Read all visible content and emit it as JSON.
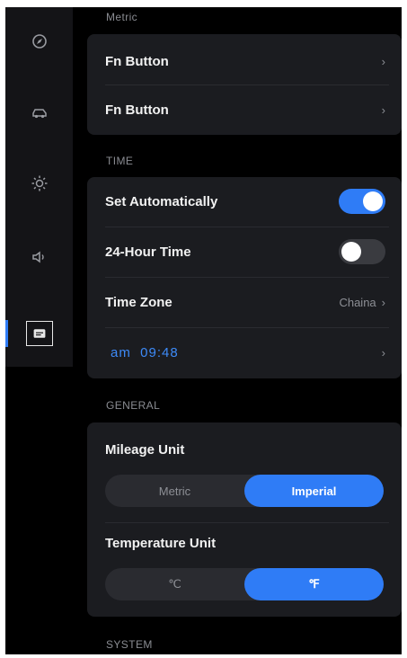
{
  "sections": {
    "metric": "Metric",
    "time": "TIME",
    "general": "GENERAL",
    "system": "SYSTEM"
  },
  "metric_card": {
    "rows": [
      {
        "label": "Fn Button"
      },
      {
        "label": "Fn Button"
      }
    ]
  },
  "time_card": {
    "set_automatically": {
      "label": "Set Automatically",
      "on": true
    },
    "hour24": {
      "label": "24-Hour Time",
      "on": false
    },
    "time_zone": {
      "label": "Time Zone",
      "value": "Chaina"
    },
    "clock": {
      "value": "am  09:48"
    }
  },
  "general_card": {
    "mileage": {
      "label": "Mileage Unit",
      "options": [
        "Metric",
        "Imperial"
      ],
      "selected": "Imperial"
    },
    "temperature": {
      "label": "Temperature Unit",
      "options": [
        "℃",
        "℉"
      ],
      "selected": "℉"
    }
  },
  "icons": {
    "chevron": "›",
    "sidebar": [
      "compass-icon",
      "car-icon",
      "brightness-icon",
      "volume-icon",
      "settings-card-icon"
    ]
  },
  "colors": {
    "accent": "#2f7cf6",
    "card": "#1b1c20",
    "background": "#000000"
  }
}
